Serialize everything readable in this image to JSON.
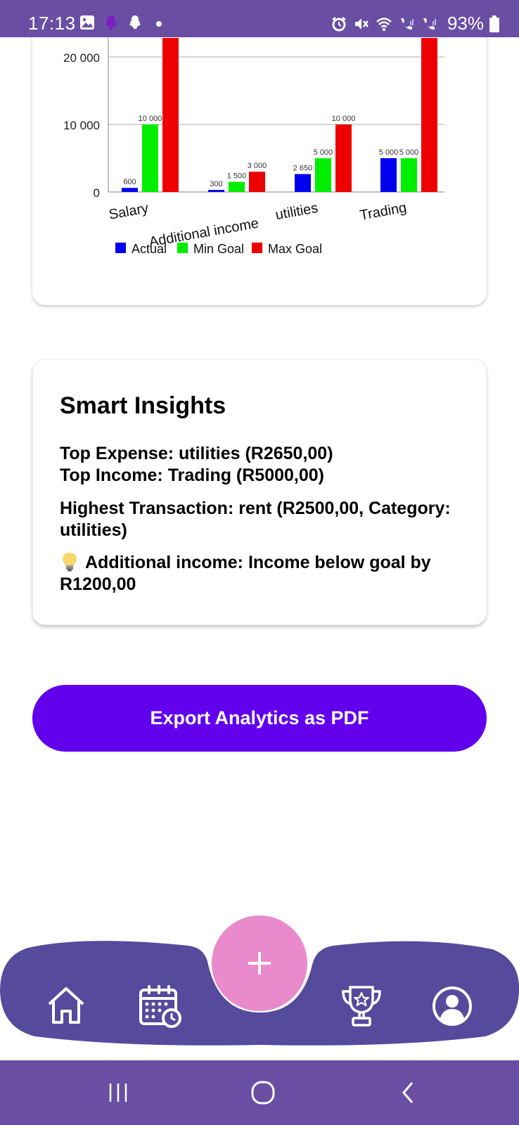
{
  "status_bar": {
    "time": "17:13",
    "battery": "93%",
    "left_icons": [
      "gallery-icon",
      "alarm-bell-icon",
      "snapchat-icon",
      "dot-icon"
    ],
    "right_icons": [
      "alarm-clock-icon",
      "mute-icon",
      "wifi-icon",
      "volte-signal-1-icon",
      "volte-signal-2-icon",
      "battery-icon"
    ]
  },
  "chart_data": {
    "type": "bar",
    "categories": [
      "Salary",
      "Additional income",
      "utilities",
      "Trading"
    ],
    "series": [
      {
        "name": "Actual",
        "color": "#0000ee",
        "values": [
          600,
          300,
          2650,
          5000
        ]
      },
      {
        "name": "Min Goal",
        "color": "#00ee00",
        "values": [
          10000,
          1500,
          5000,
          5000
        ]
      },
      {
        "name": "Max Goal",
        "color": "#ee0000",
        "values": [
          null,
          3000,
          10000,
          null
        ]
      }
    ],
    "value_labels": {
      "Actual": [
        "600",
        "300",
        "2 650",
        "5 000"
      ],
      "Min Goal": [
        "10 000",
        "1 500",
        "5 000",
        "5 000"
      ],
      "Max Goal": [
        "",
        "3 000",
        "10 000",
        ""
      ]
    },
    "y_ticks": [
      "0",
      "10 000",
      "20 000"
    ],
    "y_tick_values": [
      0,
      10000,
      20000
    ],
    "ylim": [
      0,
      22000
    ],
    "legend_position": "bottom",
    "grid": true,
    "note": "Salary and Trading Max Goal bars extend beyond the visible top of the chart"
  },
  "insights": {
    "title": "Smart Insights",
    "top_expense": "Top Expense: utilities (R2650,00)",
    "top_income": "Top Income: Trading (R5000,00)",
    "highest_transaction": "Highest Transaction: rent (R2500,00, Category: utilities)",
    "tip_icon": "lightbulb-icon",
    "tip": "Additional income: Income below goal by R1200,00"
  },
  "export_button": {
    "label": "Export Analytics as PDF"
  },
  "bottom_nav": {
    "fab_icon": "plus-icon",
    "items": [
      "home-icon",
      "calendar-clock-icon",
      "trophy-icon",
      "profile-icon"
    ],
    "colors": {
      "bar": "#564a9c",
      "fab": "#e98acd"
    }
  },
  "system_nav": {
    "icons": [
      "recents-icon",
      "home-circle-icon",
      "back-icon"
    ]
  },
  "colors": {
    "status_bar": "#6a4ea3",
    "accent_button": "#6200ee"
  }
}
